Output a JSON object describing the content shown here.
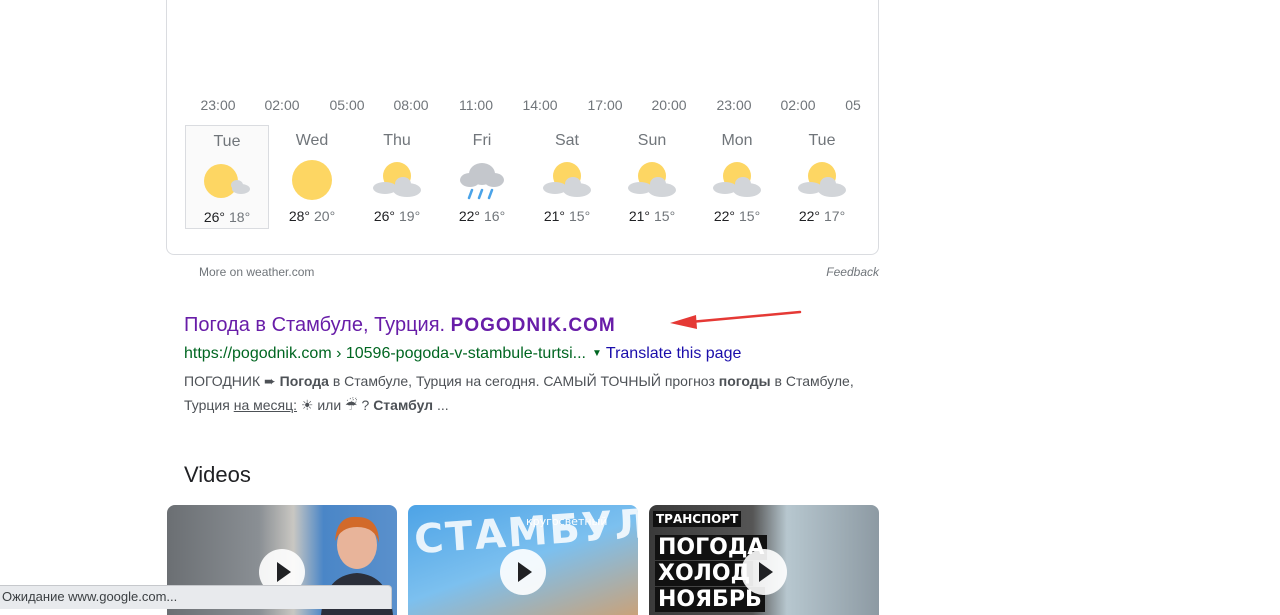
{
  "weather": {
    "hours": [
      "23:00",
      "02:00",
      "05:00",
      "08:00",
      "11:00",
      "14:00",
      "17:00",
      "20:00",
      "23:00",
      "02:00",
      "05"
    ],
    "days": [
      {
        "name": "Tue",
        "hi": "26°",
        "lo": "18°",
        "icon": "sun-cloud-icon",
        "selected": true
      },
      {
        "name": "Wed",
        "hi": "28°",
        "lo": "20°",
        "icon": "sun-icon"
      },
      {
        "name": "Thu",
        "hi": "26°",
        "lo": "19°",
        "icon": "partly-cloudy-icon"
      },
      {
        "name": "Fri",
        "hi": "22°",
        "lo": "16°",
        "icon": "rain-icon"
      },
      {
        "name": "Sat",
        "hi": "21°",
        "lo": "15°",
        "icon": "partly-cloudy-icon"
      },
      {
        "name": "Sun",
        "hi": "21°",
        "lo": "15°",
        "icon": "partly-cloudy-icon"
      },
      {
        "name": "Mon",
        "hi": "22°",
        "lo": "15°",
        "icon": "partly-cloudy-icon"
      },
      {
        "name": "Tue",
        "hi": "22°",
        "lo": "17°",
        "icon": "partly-cloudy-icon"
      }
    ],
    "more_link": "More on weather.com",
    "feedback": "Feedback"
  },
  "result": {
    "title": "Погода в Стамбуле, Турция.",
    "title_brand": "POGODNIK.COM",
    "url": "https://pogodnik.com › 10596-pogoda-v-stambule-turtsi...",
    "translate": "Translate this page",
    "snippet": {
      "p1": "ПОГОДНИК ➨ ",
      "b1": "Погода",
      "p2": " в Стамбуле, Турция на сегодня. САМЫЙ ТОЧНЫЙ прогноз ",
      "b2": "погоды",
      "p3": " в Стамбуле, Турция ",
      "u1": "на месяц:",
      "p4": " ☀ или ☔ ? ",
      "b3": "Стамбул",
      "p5": " ..."
    }
  },
  "videos": {
    "heading": "Videos",
    "items": [
      {
        "texts": []
      },
      {
        "big": "СТАМБУЛ",
        "small": "кругосветный"
      },
      {
        "tag": "ТРАНСПОРТ",
        "l1": "ПОГОДА",
        "l2": "ХОЛОД",
        "l3": "НОЯБРЬ"
      }
    ]
  },
  "status_bar": "Ожидание www.google.com...",
  "colors": {
    "visited_link": "#681da8",
    "url_green": "#006621",
    "link_blue": "#1a0dab",
    "annotation_arrow": "#e53935",
    "sun": "#fdd663",
    "cloud": "#d2d5d9"
  }
}
